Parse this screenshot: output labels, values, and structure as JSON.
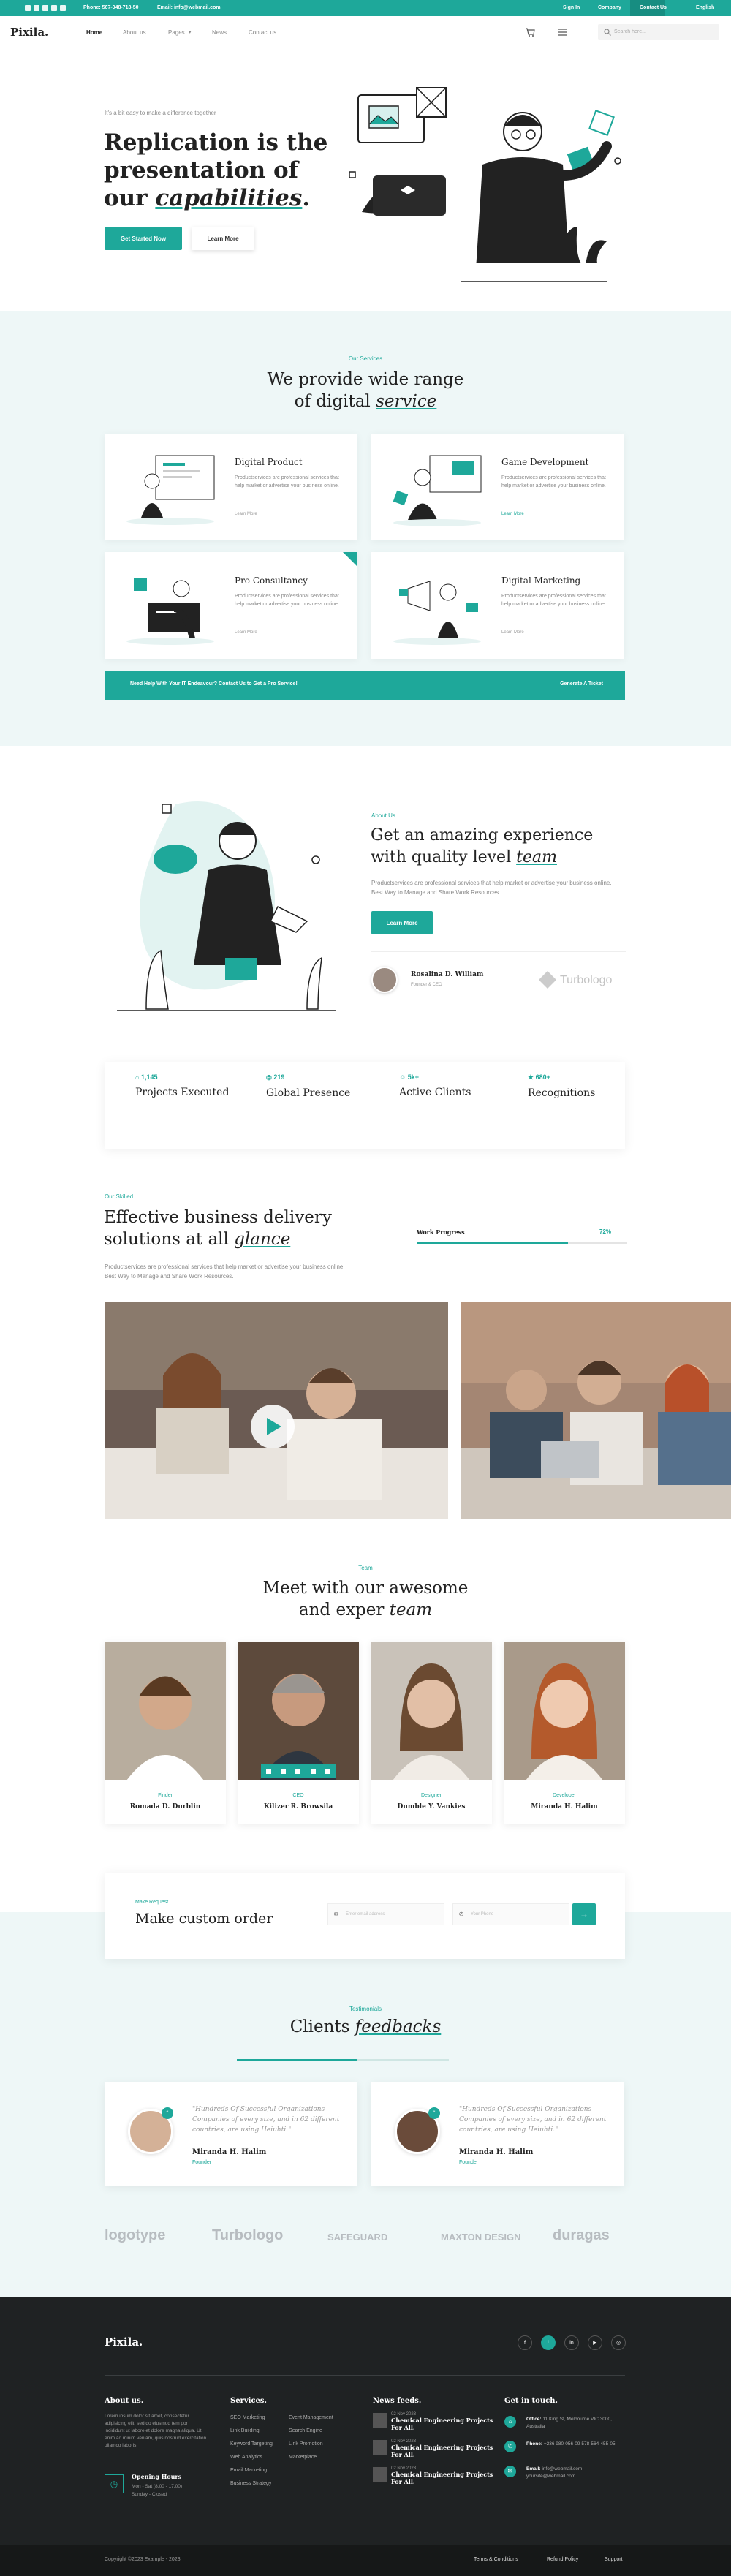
{
  "topbar": {
    "phone": "Phone: 567-048-718-50",
    "email": "Email: info@webmail.com",
    "signin": "Sign In",
    "company": "Company",
    "contact": "Contact Us",
    "lang": "English"
  },
  "brand": "Pixila.",
  "nav": {
    "items": [
      "Home",
      "About us",
      "Pages",
      "News",
      "Contact us"
    ],
    "search_placeholder": "Search here..."
  },
  "hero": {
    "tagline": "It's a bit easy to make a difference together",
    "title_1": "Replication is the",
    "title_2": "presentation of",
    "title_3": "our",
    "title_em": "capabilities",
    "title_end": ".",
    "btn_primary": "Get Started Now",
    "btn_secondary": "Learn More"
  },
  "services": {
    "eyebrow": "Our Services",
    "title_1": "We provide wide range",
    "title_2": "of digital",
    "title_em": "service",
    "cards": [
      {
        "title": "Digital Product",
        "desc": "Productservices are professional services that help market or advertise your business online.",
        "link": "Learn More"
      },
      {
        "title": "Game Development",
        "desc": "Productservices are professional services that help market or advertise your business online.",
        "link": "Learn More"
      },
      {
        "title": "Pro Consultancy",
        "desc": "Productservices are professional services that help market or advertise your business online.",
        "link": "Learn More"
      },
      {
        "title": "Digital Marketing",
        "desc": "Productservices are professional services that help market or advertise your business online.",
        "link": "Learn More"
      }
    ],
    "banner_text": "Need Help With Your IT Endeavour? Contact Us to Get a Pro Service!",
    "banner_link": "Generate A Ticket"
  },
  "about": {
    "eyebrow": "About Us",
    "title_1": "Get an amazing experience",
    "title_2": "with quality level",
    "title_em": "team",
    "desc": "Productservices are professional services that help market or advertise your business online. Best Way to Manage and Share Work Resources.",
    "btn": "Learn More",
    "person_name": "Rosalina D. William",
    "person_role": "Founder & CEO",
    "partner_logo": "Turbologo"
  },
  "stats": [
    {
      "num": "1,145",
      "label": "Projects Executed"
    },
    {
      "num": "219",
      "label": "Global Presence"
    },
    {
      "num": "5k+",
      "label": "Active Clients"
    },
    {
      "num": "680+",
      "label": "Recognitions"
    }
  ],
  "skills": {
    "eyebrow": "Our Skilled",
    "title_1": "Effective business delivery",
    "title_2": "solutions at all",
    "title_em": "glance",
    "desc": "Productservices are professional services that help market or advertise your business online. Best Way to Manage and Share Work Resources.",
    "progress_label": "Work Progress",
    "progress_value": "72%",
    "progress": 0.72
  },
  "team": {
    "eyebrow": "Team",
    "title_1": "Meet with our awesome",
    "title_2": "and exper",
    "title_em": "team",
    "members": [
      {
        "role": "Finder",
        "name": "Romada D. Durblin"
      },
      {
        "role": "CEO",
        "name": "Kilizer R. Browsila"
      },
      {
        "role": "Designer",
        "name": "Dumble Y. Vankies"
      },
      {
        "role": "Developer",
        "name": "Miranda H. Halim"
      }
    ]
  },
  "order": {
    "eyebrow": "Make Request",
    "title": "Make custom order",
    "email_placeholder": "Enter email address",
    "phone_placeholder": "Your Phone"
  },
  "testimonials": {
    "eyebrow": "Testimonials",
    "title": "Clients",
    "title_em": "feedbacks",
    "items": [
      {
        "quote": "\"Hundreds Of Successful Organizations Companies of every size, and in 62 different countries, are using Heiuhti.\"",
        "name": "Miranda H. Halim",
        "role": "Founder"
      },
      {
        "quote": "\"Hundreds Of Successful Organizations Companies of every size, and in 62 different countries, are using Heiuhti.\"",
        "name": "Miranda H. Halim",
        "role": "Founder"
      }
    ]
  },
  "partners": [
    "logotype",
    "Turbologo",
    "SAFEGUARD",
    "MAXTON DESIGN",
    "duragas"
  ],
  "footer": {
    "brand": "Pixila.",
    "about_title": "About us.",
    "about_text": "Lorem ipsum dolor sit amet, consectetur adipisicing elit, sed do eiusmod tem por incididunt ut labore et dolore magna aliqua. Ut enim ad minim veniam, quis nostrud exercitation ullamco laboris.",
    "hours_title": "Opening Hours",
    "hours_1": "Mon - Sat (8.00 - 17.00)",
    "hours_2": "Sunday - Closed",
    "services_title": "Services.",
    "services_col1": [
      "SEO Marketing",
      "Link Building",
      "Keyword Targeting",
      "Web Analytics",
      "Email Marketing",
      "Business Strategy"
    ],
    "services_col2": [
      "Event Management",
      "Search Engine",
      "Link Promotion",
      "Marketplace"
    ],
    "news_title": "News feeds.",
    "news": [
      {
        "date": "02 Nov 2023",
        "title": "Chemical Engineering Projects For All."
      },
      {
        "date": "02 Nov 2023",
        "title": "Chemical Engineering Projects For All."
      },
      {
        "date": "02 Nov 2023",
        "title": "Chemical Engineering Projects For All."
      }
    ],
    "contact_title": "Get in touch.",
    "office_label": "Office:",
    "office": "11 King St, Melbourne VIC 3000, Australia",
    "phone_label": "Phone:",
    "phone": "+236 980-056-09 578-564-455-05",
    "email_label": "Email:",
    "email": "info@webmail.com yoursite@webmail.com",
    "copyright": "Copyright ©2023 Example - 2023",
    "links": [
      "Terms & Conditions",
      "Refund Policy",
      "Support"
    ]
  },
  "colors": {
    "accent": "#1ea89a",
    "footer_bg": "#1f2223",
    "light_bg": "#eef7f7"
  }
}
